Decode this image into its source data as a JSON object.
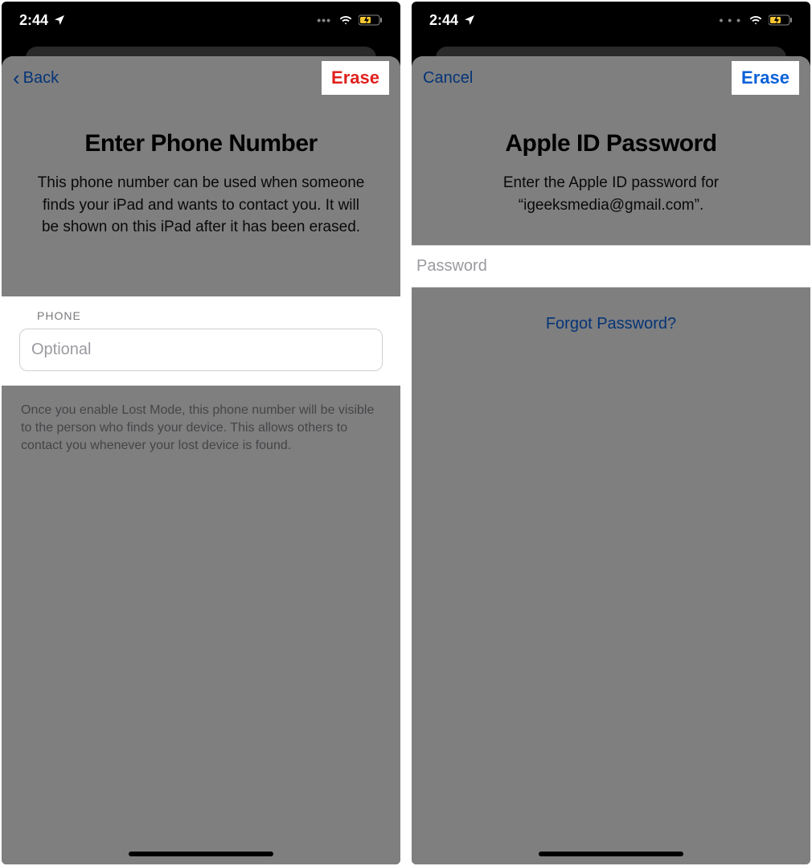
{
  "status": {
    "time": "2:44"
  },
  "left": {
    "back_label": "Back",
    "erase_label": "Erase",
    "title": "Enter Phone Number",
    "description": "This phone number can be used when someone finds your iPad and wants to contact you. It will be shown on this iPad after it has been erased.",
    "section_label": "PHONE",
    "phone_placeholder": "Optional",
    "footnote": "Once you enable Lost Mode, this phone number will be visible to the person who finds your device. This allows others to contact you whenever your lost device is found."
  },
  "right": {
    "cancel_label": "Cancel",
    "erase_label": "Erase",
    "title": "Apple ID Password",
    "description": "Enter the Apple ID password for “igeeksmedia@gmail.com”.",
    "password_placeholder": "Password",
    "forgot_label": "Forgot Password?"
  }
}
